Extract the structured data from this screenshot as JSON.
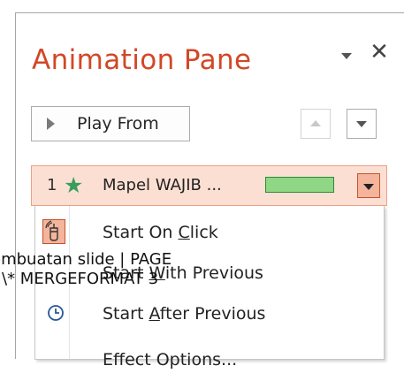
{
  "pane": {
    "title": "Animation Pane",
    "options_icon": "chevron-down-icon",
    "close_label": "✕"
  },
  "toolbar": {
    "play_from_label": "Play From",
    "move_up_icon": "triangle-up-icon",
    "move_down_icon": "triangle-down-icon"
  },
  "animation_item": {
    "order": "1",
    "effect_icon": "star-icon",
    "name": "Mapel WAJIB ...",
    "timing_bar_color": "#8fd685",
    "dropdown_icon": "triangle-down-icon"
  },
  "context_menu": {
    "items": [
      {
        "pre": "Start On ",
        "key": "C",
        "post": "lick",
        "icon": "mouse-click-icon"
      },
      {
        "pre": "Start ",
        "key": "W",
        "post": "ith Previous",
        "icon": ""
      },
      {
        "pre": "Start ",
        "key": "A",
        "post": "fter Previous",
        "icon": "clock-icon"
      },
      {
        "pre": "Effect Options...",
        "key": "",
        "post": "",
        "icon": ""
      }
    ]
  },
  "document_field": {
    "line1": "embuatan slide | PAGE",
    "line2": "\\* MERGEFORMAT 3"
  },
  "colors": {
    "title": "#d24726",
    "selection": "#fcdfd3",
    "star": "#3a9d5d",
    "accent_border": "#c4532c"
  }
}
